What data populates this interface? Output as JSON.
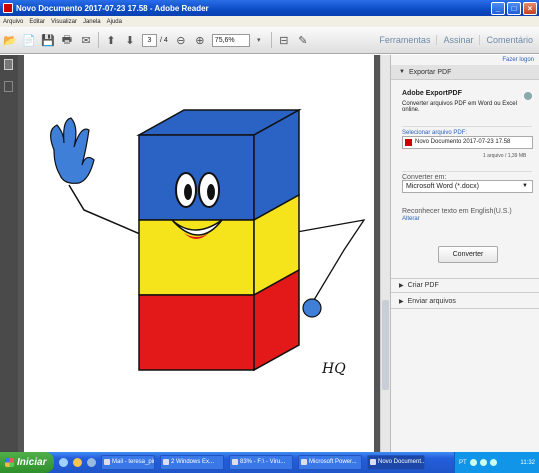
{
  "window": {
    "title": "Novo Documento 2017-07-23 17.58 - Adobe Reader"
  },
  "menu": [
    "Arquivo",
    "Editar",
    "Visualizar",
    "Janela",
    "Ajuda"
  ],
  "toolbar": {
    "page_current": "3",
    "page_total": "/ 4",
    "zoom": "75,6%"
  },
  "right_links": [
    "Ferramentas",
    "Assinar",
    "Comentário"
  ],
  "pane": {
    "login_link": "Fazer logon",
    "export_header": "Exportar PDF",
    "service_title": "Adobe ExportPDF",
    "service_desc": "Converter arquivos PDF em Word ou Excel online.",
    "select_file_label": "Selecionar arquivo PDF:",
    "file_name": "Novo Documento 2017-07-23 17.58",
    "file_info": "1 arquivo / 1,39 MB",
    "convert_label": "Converter em:",
    "convert_option": "Microsoft Word (*.docx)",
    "ocr_text": "Reconhecer texto em English(U.S.)",
    "change_link": "Alterar",
    "convert_button": "Converter",
    "create_header": "Criar PDF",
    "send_header": "Enviar arquivos"
  },
  "taskbar": {
    "start": "Iniciar",
    "tasks": [
      "Mail - teresa_pin...",
      "2 Windows Ex...",
      "83% - F:\\ - Viru...",
      "Microsoft Power...",
      "Novo Document..."
    ],
    "lang": "PT",
    "clock": "11:32"
  },
  "colors": {
    "blue_face": "#2a63c4",
    "yellow_band": "#f5e41c",
    "red_band": "#e31818",
    "accent_link": "#2b62b8"
  }
}
